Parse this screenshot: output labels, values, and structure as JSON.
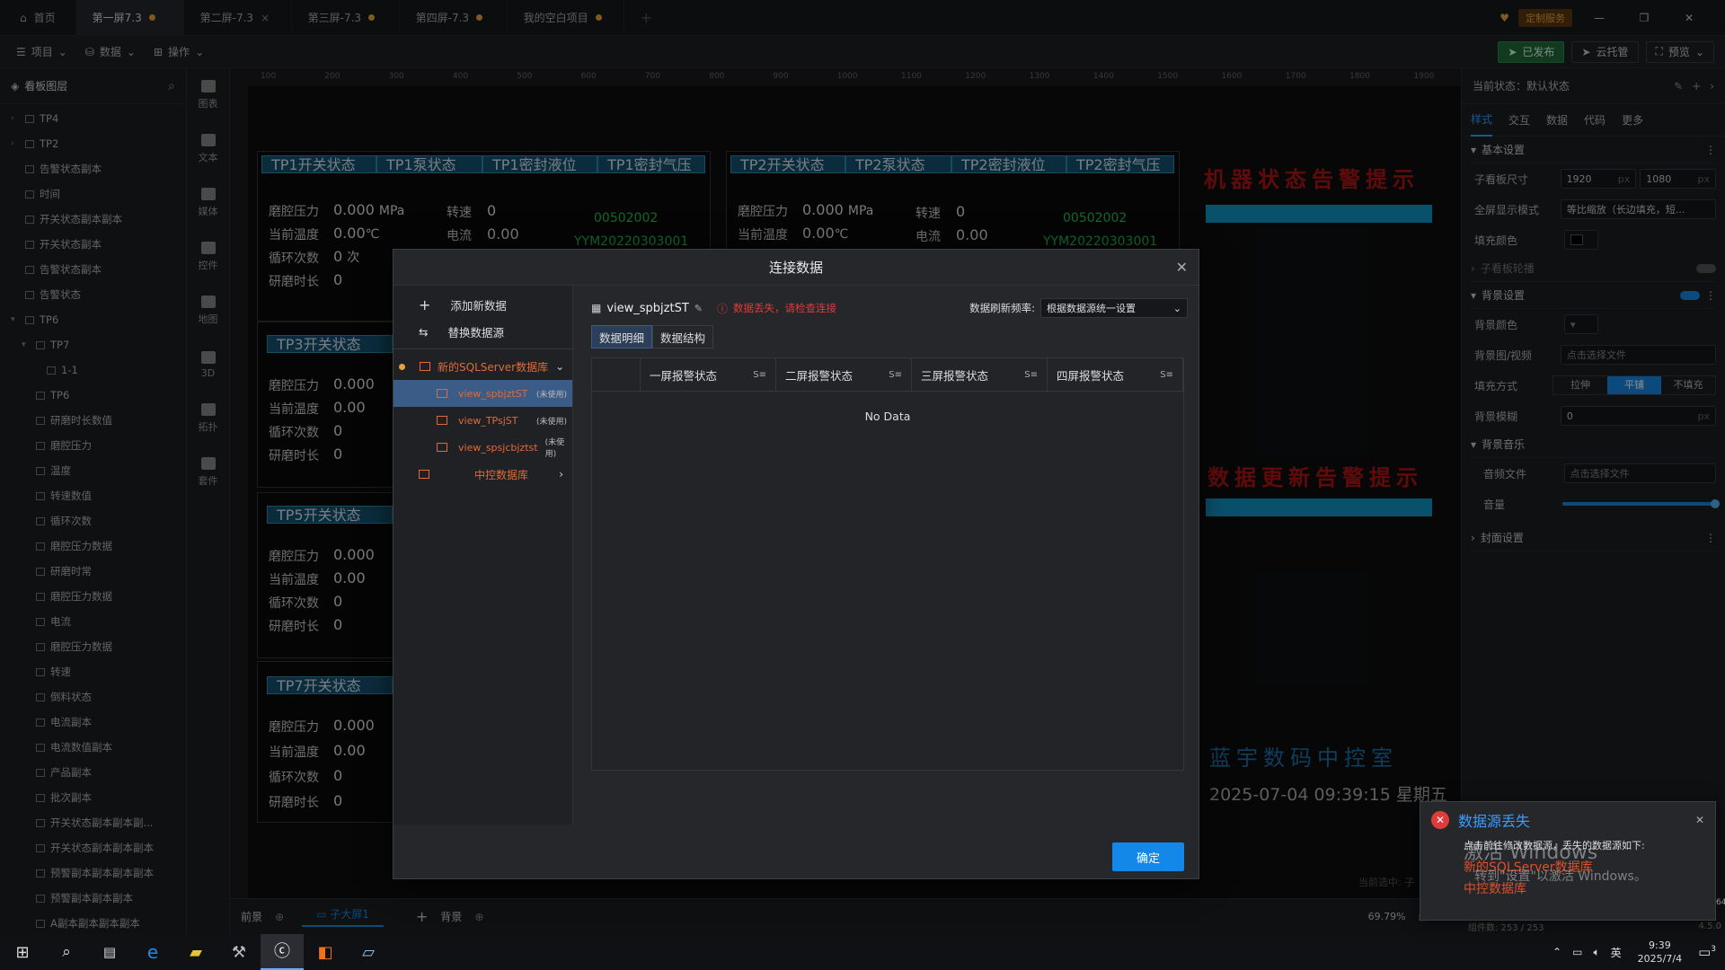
{
  "tabs": {
    "home": "首页",
    "items": [
      {
        "label": "第一屏7.3",
        "modified": true,
        "active": true
      },
      {
        "label": "第二屏-7.3",
        "modified": false,
        "active": false
      },
      {
        "label": "第三屏-7.3",
        "modified": true,
        "active": false
      },
      {
        "label": "第四屏-7.3",
        "modified": true,
        "active": false
      },
      {
        "label": "我的空白项目",
        "modified": true,
        "active": false
      }
    ],
    "custom_service": "定制服务"
  },
  "toolbar": {
    "project": "项目",
    "data": "数据",
    "operate": "操作",
    "published": "已发布",
    "cloud_host": "云托管",
    "preview": "预览"
  },
  "layers": {
    "title": "看板图层",
    "items": [
      {
        "label": "TP4",
        "indent": 0,
        "arrow": "right"
      },
      {
        "label": "TP2",
        "indent": 0,
        "arrow": "right"
      },
      {
        "label": "告警状态副本",
        "indent": 0,
        "arrow": ""
      },
      {
        "label": "时间",
        "indent": 0,
        "arrow": ""
      },
      {
        "label": "开关状态副本副本",
        "indent": 0,
        "arrow": ""
      },
      {
        "label": "开关状态副本",
        "indent": 0,
        "arrow": ""
      },
      {
        "label": "告警状态副本",
        "indent": 0,
        "arrow": ""
      },
      {
        "label": "告警状态",
        "indent": 0,
        "arrow": ""
      },
      {
        "label": "TP6",
        "indent": 0,
        "arrow": "down"
      },
      {
        "label": "TP7",
        "indent": 1,
        "arrow": "down"
      },
      {
        "label": "1-1",
        "indent": 2,
        "arrow": ""
      },
      {
        "label": "TP6",
        "indent": 1,
        "arrow": ""
      },
      {
        "label": "研磨时长数值",
        "indent": 1,
        "arrow": ""
      },
      {
        "label": "磨腔压力",
        "indent": 1,
        "arrow": ""
      },
      {
        "label": "温度",
        "indent": 1,
        "arrow": ""
      },
      {
        "label": "转速数值",
        "indent": 1,
        "arrow": ""
      },
      {
        "label": "循环次数",
        "indent": 1,
        "arrow": ""
      },
      {
        "label": "磨腔压力数据",
        "indent": 1,
        "arrow": ""
      },
      {
        "label": "研磨时常",
        "indent": 1,
        "arrow": ""
      },
      {
        "label": "磨腔压力数据",
        "indent": 1,
        "arrow": ""
      },
      {
        "label": "电流",
        "indent": 1,
        "arrow": ""
      },
      {
        "label": "磨腔压力数据",
        "indent": 1,
        "arrow": ""
      },
      {
        "label": "转速",
        "indent": 1,
        "arrow": ""
      },
      {
        "label": "倒料状态",
        "indent": 1,
        "arrow": ""
      },
      {
        "label": "电流副本",
        "indent": 1,
        "arrow": ""
      },
      {
        "label": "电流数值副本",
        "indent": 1,
        "arrow": ""
      },
      {
        "label": "产品副本",
        "indent": 1,
        "arrow": ""
      },
      {
        "label": "批次副本",
        "indent": 1,
        "arrow": ""
      },
      {
        "label": "开关状态副本副本副...",
        "indent": 1,
        "arrow": ""
      },
      {
        "label": "开关状态副本副本副本",
        "indent": 1,
        "arrow": ""
      },
      {
        "label": "预警副本副本副本副本",
        "indent": 1,
        "arrow": ""
      },
      {
        "label": "预警副本副本副本",
        "indent": 1,
        "arrow": ""
      },
      {
        "label": "A副本副本副本副本",
        "indent": 1,
        "arrow": ""
      }
    ]
  },
  "rail": [
    "图表",
    "文本",
    "媒体",
    "控件",
    "地图",
    "3D",
    "拓扑",
    "套件"
  ],
  "ruler_ticks": [
    "100",
    "200",
    "300",
    "400",
    "500",
    "600",
    "700",
    "800",
    "900",
    "1000",
    "1100",
    "1200",
    "1300",
    "1400",
    "1500",
    "1600",
    "1700",
    "1800",
    "1900"
  ],
  "canvas": {
    "card1_headers": [
      "TP1开关状态",
      "TP1泵状态",
      "TP1密封液位",
      "TP1密封气压"
    ],
    "card2_headers": [
      "TP2开关状态",
      "TP2泵状态",
      "TP2密封液位",
      "TP2密封气压"
    ],
    "tp3": "TP3开关状态",
    "tp5": "TP5开关状态",
    "tp7": "TP7开关状态",
    "labels": {
      "pressure": "磨腔压力",
      "temp": "当前温度",
      "cycles": "循环次数",
      "grind": "研磨时长",
      "speed": "转速",
      "current": "电流"
    },
    "values": {
      "pressure": "0.000",
      "pressure_unit": "MPa",
      "temp": "0.00",
      "temp_unit": "℃",
      "cycles": "0",
      "cycles_unit": "次",
      "grind": "0",
      "speed": "0",
      "current": "0.00"
    },
    "code1": "00502002",
    "code2": "YYM20220303001",
    "alarm_title": "机器状态告警提示",
    "update_title": "数据更新告警提示",
    "room_title": "蓝宇数码中控室",
    "datetime": "2025-07-04 09:39:15 星期五",
    "current_selected": "当前选中: 子"
  },
  "props": {
    "state_label": "当前状态：默认状态",
    "tabs": [
      "样式",
      "交互",
      "数据",
      "代码",
      "更多"
    ],
    "basic": "基本设置",
    "size_label": "子看板尺寸",
    "width": "1920",
    "height": "1080",
    "px": "px",
    "fullscreen_label": "全屏显示模式",
    "fullscreen_value": "等比缩放（长边填充，短...",
    "fill_color": "填充颜色",
    "carousel": "子看板轮播",
    "bg_settings": "背景设置",
    "bg_color": "背景颜色",
    "bg_image": "背景图/视频",
    "choose_file": "点击选择文件",
    "fill_mode": "填充方式",
    "fill_opts": [
      "拉伸",
      "平铺",
      "不填充"
    ],
    "bg_blur": "背景模糊",
    "blur_value": "0",
    "bg_music": "背景音乐",
    "audio_file": "音频文件",
    "volume": "音量",
    "cover": "封面设置"
  },
  "bottom": {
    "front": "前景",
    "sub": "子大屏1",
    "back": "背景",
    "zoom": "69.79%",
    "components": "组件数: 253 / 253",
    "version": "4.5.0",
    "right64": "64"
  },
  "modal": {
    "title": "连接数据",
    "add_new": "添加新数据",
    "replace": "替换数据源",
    "db1": "新的SQLServer数据库",
    "tables": [
      {
        "name": "view_spbjztST",
        "tag": "(未使用)",
        "selected": true
      },
      {
        "name": "view_TPsjST",
        "tag": "(未使用)",
        "selected": false
      },
      {
        "name": "view_spsjcbjztst",
        "tag": "(未使用)",
        "selected": false
      }
    ],
    "db2": "中控数据库",
    "view_name": "view_spbjztST",
    "error": "数据丢失，请检查连接",
    "refresh_label": "数据刷新频率:",
    "refresh_value": "根据数据源统一设置",
    "subtabs": [
      "数据明细",
      "数据结构"
    ],
    "columns": [
      "一屏报警状态",
      "二屏报警状态",
      "三屏报警状态",
      "四屏报警状态"
    ],
    "sort_icon": "S≡",
    "no_data": "No Data",
    "ok": "确定"
  },
  "notif": {
    "title": "数据源丢失",
    "body": "点击前往修改数据源，丢失的数据源如下:",
    "src1": "新的SQLServer数据库",
    "src2": "中控数据库",
    "watermark1": "激活 Windows",
    "watermark2": "转到\"设置\"以激活 Windows。"
  },
  "taskbar": {
    "ime": "英",
    "time": "9:39",
    "date": "2025/7/4",
    "notif_count": "3"
  },
  "colors": {
    "accent": "#1488e8",
    "error": "#e03b3b",
    "brand_orange": "#e06a3a",
    "panel_blue": "#14506e",
    "alarm_red": "#b01515"
  }
}
